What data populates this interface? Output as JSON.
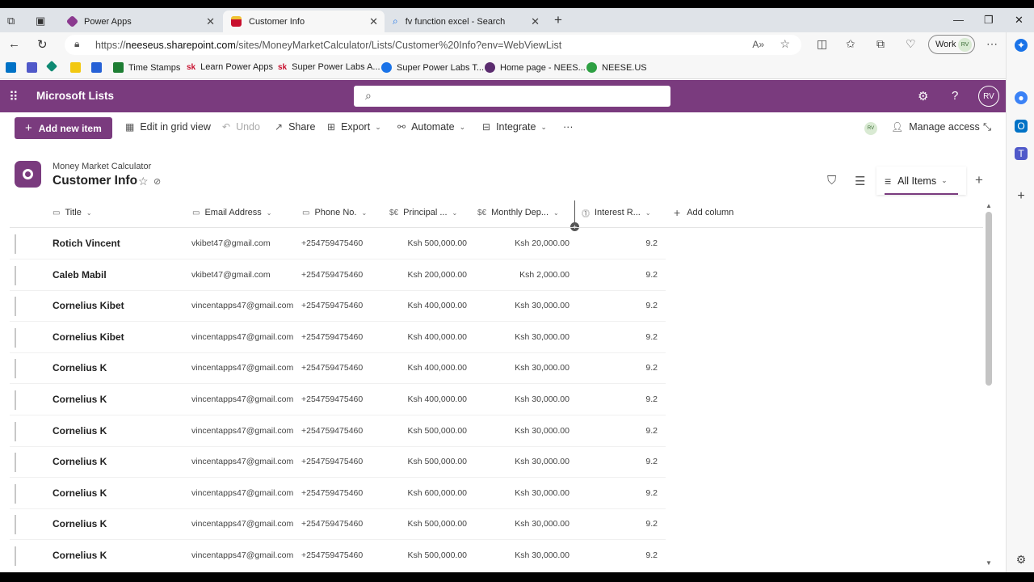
{
  "browser": {
    "tabs": [
      {
        "label": "Power Apps",
        "color": "#8b3a8f"
      },
      {
        "label": "Customer Info",
        "color": "#c8102e"
      },
      {
        "label": "fv function excel - Search",
        "color": "#1a73e8"
      }
    ],
    "url_prefix": "https://",
    "url_host": "neeseus.sharepoint.com",
    "url_path": "/sites/MoneyMarketCalculator/Lists/Customer%20Info?env=WebViewList",
    "profile_label": "Work",
    "profile_initials": "RV"
  },
  "bookmarks": [
    {
      "label": "Time Stamps",
      "color": "#1e7e34"
    },
    {
      "label": "Learn Power Apps",
      "color": "#c8102e",
      "glyph": "sk"
    },
    {
      "label": "Super Power Labs A...",
      "color": "#c8102e",
      "glyph": "sk"
    },
    {
      "label": "Super Power Labs T...",
      "color": "#1a73e8"
    },
    {
      "label": "Home page - NEES...",
      "color": "#5b2c6f"
    },
    {
      "label": "NEESE.US",
      "color": "#2ea043"
    }
  ],
  "app": {
    "name": "Microsoft Lists",
    "user_initials": "RV",
    "accent": "#7a3b7e"
  },
  "commands": {
    "add_new_item": "Add new item",
    "edit_grid": "Edit in grid view",
    "undo": "Undo",
    "share": "Share",
    "export": "Export",
    "automate": "Automate",
    "integrate": "Integrate",
    "more": "···",
    "manage_access": "Manage access",
    "rv_initials": "RV"
  },
  "list": {
    "site_name": "Money Market Calculator",
    "title": "Customer Info",
    "view_name": "All Items"
  },
  "columns": {
    "title": "Title",
    "email": "Email Address",
    "phone": "Phone No.",
    "principal": "Principal ...",
    "monthly": "Monthly Dep...",
    "interest": "Interest R...",
    "add_column": "Add column"
  },
  "rows": [
    {
      "title": "Rotich Vincent",
      "email": "vkibet47@gmail.com",
      "phone": "+254759475460",
      "principal": "Ksh 500,000.00",
      "monthly": "Ksh 20,000.00",
      "interest": "9.2"
    },
    {
      "title": "Caleb Mabil",
      "email": "vkibet47@gmail.com",
      "phone": "+254759475460",
      "principal": "Ksh 200,000.00",
      "monthly": "Ksh 2,000.00",
      "interest": "9.2"
    },
    {
      "title": "Cornelius Kibet",
      "email": "vincentapps47@gmail.com",
      "phone": "+254759475460",
      "principal": "Ksh 400,000.00",
      "monthly": "Ksh 30,000.00",
      "interest": "9.2"
    },
    {
      "title": "Cornelius Kibet",
      "email": "vincentapps47@gmail.com",
      "phone": "+254759475460",
      "principal": "Ksh 400,000.00",
      "monthly": "Ksh 30,000.00",
      "interest": "9.2"
    },
    {
      "title": "Cornelius K",
      "email": "vincentapps47@gmail.com",
      "phone": "+254759475460",
      "principal": "Ksh 400,000.00",
      "monthly": "Ksh 30,000.00",
      "interest": "9.2"
    },
    {
      "title": "Cornelius K",
      "email": "vincentapps47@gmail.com",
      "phone": "+254759475460",
      "principal": "Ksh 400,000.00",
      "monthly": "Ksh 30,000.00",
      "interest": "9.2"
    },
    {
      "title": "Cornelius K",
      "email": "vincentapps47@gmail.com",
      "phone": "+254759475460",
      "principal": "Ksh 500,000.00",
      "monthly": "Ksh 30,000.00",
      "interest": "9.2"
    },
    {
      "title": "Cornelius K",
      "email": "vincentapps47@gmail.com",
      "phone": "+254759475460",
      "principal": "Ksh 500,000.00",
      "monthly": "Ksh 30,000.00",
      "interest": "9.2"
    },
    {
      "title": "Cornelius K",
      "email": "vincentapps47@gmail.com",
      "phone": "+254759475460",
      "principal": "Ksh 600,000.00",
      "monthly": "Ksh 30,000.00",
      "interest": "9.2"
    },
    {
      "title": "Cornelius K",
      "email": "vincentapps47@gmail.com",
      "phone": "+254759475460",
      "principal": "Ksh 500,000.00",
      "monthly": "Ksh 30,000.00",
      "interest": "9.2"
    },
    {
      "title": "Cornelius K",
      "email": "vincentapps47@gmail.com",
      "phone": "+254759475460",
      "principal": "Ksh 500,000.00",
      "monthly": "Ksh 30,000.00",
      "interest": "9.2"
    }
  ]
}
